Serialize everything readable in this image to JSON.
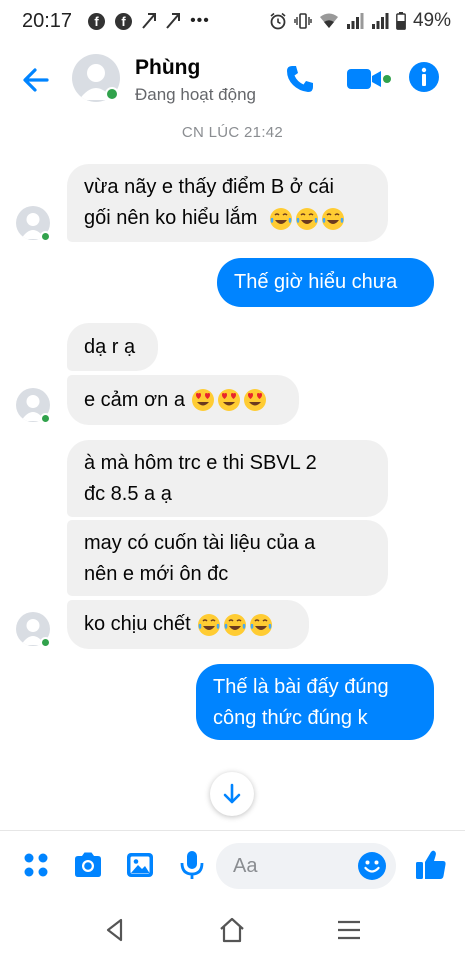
{
  "status_bar": {
    "time": "20:17",
    "battery": "49%",
    "left_icons": [
      "facebook-icon",
      "facebook-icon",
      "send-icon",
      "send-icon",
      "more-dots-icon"
    ],
    "right_icons": [
      "alarm-icon",
      "vibrate-icon",
      "wifi-icon",
      "signal-icon",
      "signal-icon",
      "battery-icon"
    ]
  },
  "header": {
    "name": "Phùng",
    "status": "Đang hoạt động"
  },
  "timestamp": "CN LÚC 21:42",
  "messages": [
    {
      "from": "them",
      "line1": "vừa nãy e thấy điểm B ở cái",
      "line2": "gối nên ko hiểu lắm",
      "emoji": [
        "tears-of-joy",
        "tears-of-joy",
        "tears-of-joy"
      ]
    },
    {
      "from": "me",
      "text": "Thế giờ hiểu chưa"
    },
    {
      "from": "them",
      "text": "dạ r ạ"
    },
    {
      "from": "them",
      "text": "e cảm ơn a",
      "emoji": [
        "heart-eyes",
        "heart-eyes",
        "heart-eyes"
      ]
    },
    {
      "from": "them",
      "line1": "à mà hôm trc e thi SBVL 2",
      "line2": "đc 8.5 a ạ"
    },
    {
      "from": "them",
      "line1": "may có cuốn tài liệu của a",
      "line2": "nên e mới ôn đc"
    },
    {
      "from": "them",
      "text": "ko chịu chết",
      "emoji": [
        "tears-of-joy",
        "tears-of-joy",
        "tears-of-joy"
      ]
    },
    {
      "from": "me",
      "line1": "Thế là bài đấy đúng",
      "line2": "công thức đúng k"
    }
  ],
  "composer": {
    "placeholder": "Aa",
    "icons": [
      "menu-dots-icon",
      "camera-icon",
      "gallery-icon",
      "microphone-icon",
      "emoji-icon",
      "thumbs-up-icon"
    ]
  },
  "colors": {
    "accent": "#0084ff",
    "incoming_bubble": "#f0f0f0",
    "online": "#31a24c"
  }
}
